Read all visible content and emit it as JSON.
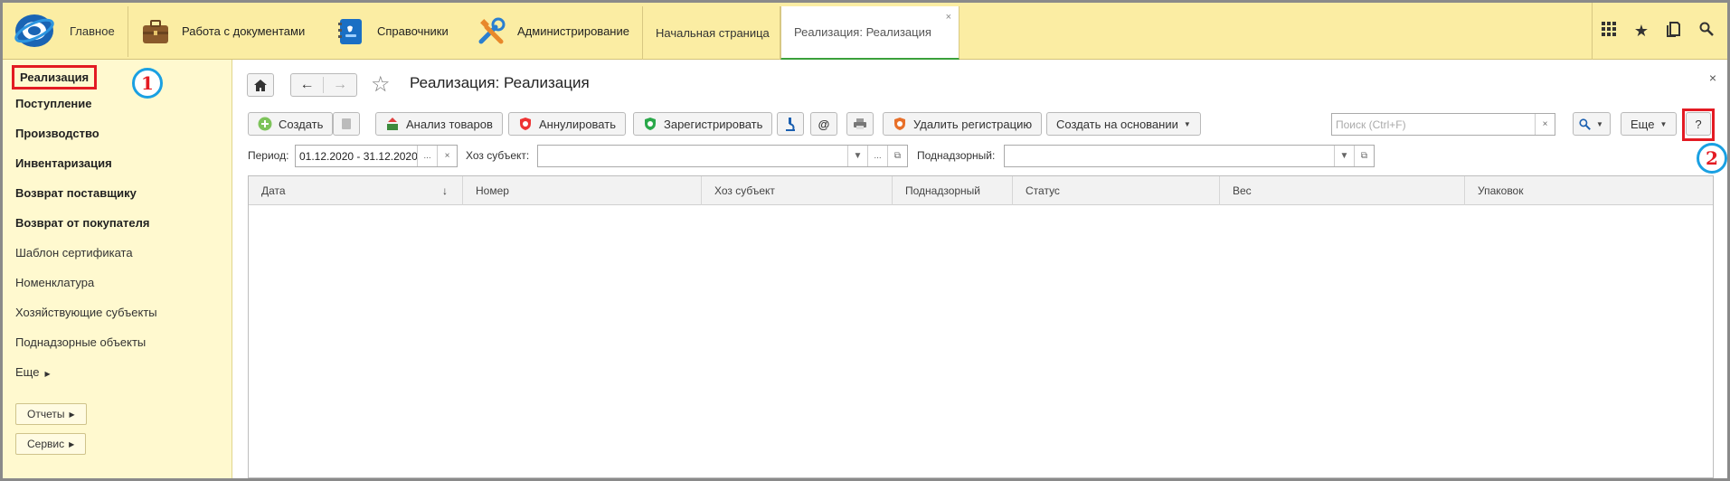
{
  "topbar": {
    "home_label": "Главное",
    "menu": [
      {
        "label": "Работа с документами"
      },
      {
        "label": "Справочники"
      },
      {
        "label": "Администрирование"
      }
    ],
    "tabs": [
      {
        "label": "Начальная страница"
      },
      {
        "label": "Реализация: Реализация",
        "close": "×"
      }
    ],
    "tools": [
      "apps-grid-icon",
      "star-icon",
      "history-icon",
      "search-icon"
    ]
  },
  "sidebar": {
    "items": [
      {
        "label": "Реализация"
      },
      {
        "label": "Поступление"
      },
      {
        "label": "Производство"
      },
      {
        "label": "Инвентаризация"
      },
      {
        "label": "Возврат поставщику"
      },
      {
        "label": "Возврат от покупателя"
      },
      {
        "label": "Шаблон сертификата"
      },
      {
        "label": "Номенклатура"
      },
      {
        "label": "Хозяйствующие субъекты"
      },
      {
        "label": "Поднадзорные объекты"
      },
      {
        "label": "Еще"
      }
    ],
    "buttons": [
      {
        "label": "Отчеты"
      },
      {
        "label": "Сервис"
      }
    ]
  },
  "badges": {
    "one": "1",
    "two": "2"
  },
  "form": {
    "title": "Реализация: Реализация",
    "close": "×",
    "toolbar": {
      "create": "Создать",
      "analyze": "Анализ товаров",
      "cancel": "Аннулировать",
      "register": "Зарегистрировать",
      "email": "@",
      "delete_reg": "Удалить регистрацию",
      "create_based": "Создать на основании",
      "more": "Еще",
      "help": "?"
    },
    "search": {
      "placeholder": "Поиск (Ctrl+F)",
      "clear": "×"
    },
    "filters": {
      "period_label": "Период:",
      "period_value": "01.12.2020 - 31.12.2020",
      "ellipsis": "...",
      "clear": "×",
      "subject_label": "Хоз субъект:",
      "subject_value": "",
      "supervised_label": "Поднадзорный:",
      "supervised_value": ""
    },
    "table": {
      "columns": [
        "Дата",
        "Номер",
        "Хоз субъект",
        "Поднадзорный",
        "Статус",
        "Вес",
        "Упаковок"
      ],
      "sort_arrow": "↓",
      "rows": []
    }
  },
  "colors": {
    "topbar": "#fbeda3",
    "sidebar": "#fff9cf",
    "highlight": "#e31b23",
    "badge_ring": "#1aa0e2"
  }
}
